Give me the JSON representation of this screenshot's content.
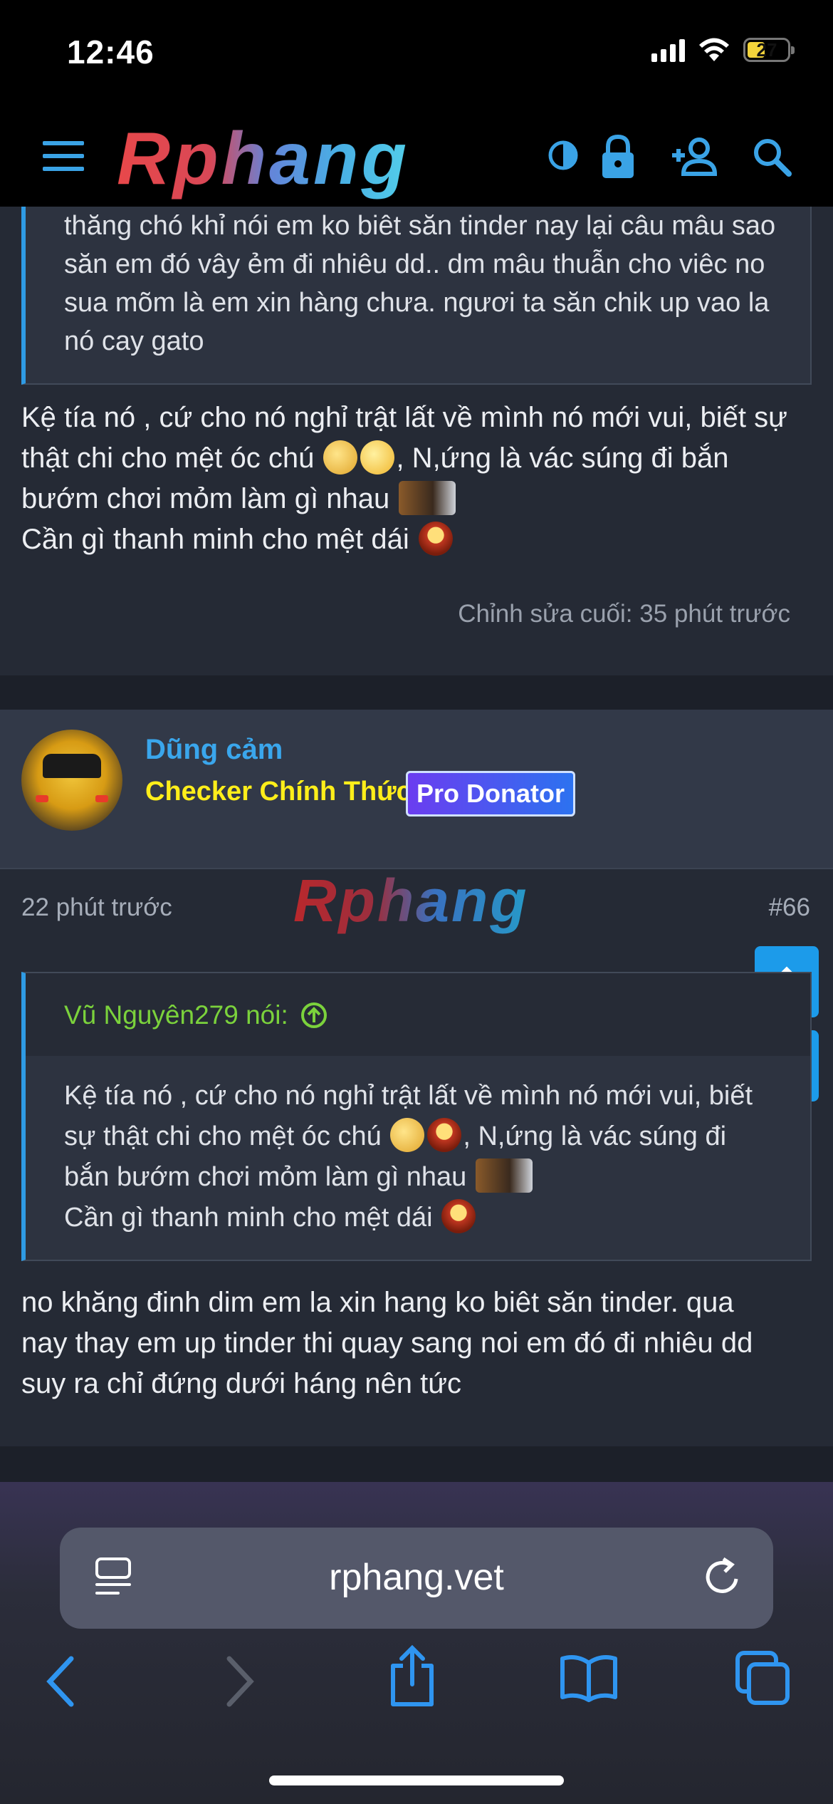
{
  "status_bar": {
    "time": "12:46",
    "battery": "27"
  },
  "header": {
    "logo": "Rphang"
  },
  "quote_top": {
    "text": "thăng chó khỉ nói em ko biêt săn tinder nay lại câu mâu sao săn em đó vây ẻm đi nhiêu dd.. dm mâu thuẫn cho viêc no sua mõm là em xin hàng chưa. ngươi ta săn chik up vao la nó cay gato"
  },
  "post1": {
    "line1": "Kệ tía nó , cứ cho nó nghỉ trật lất về mình nó mới vui, biết sự",
    "line2": "thật chi cho mệt óc chú",
    "line2b": ", N,ứng là vác súng đi bắn",
    "line3": "bướm chơi mỏm làm gì nhau",
    "line4": "Cần gì thanh minh cho mệt dái",
    "edited": "Chỉnh sửa cuối: 35 phút trước"
  },
  "post2": {
    "username": "Dũng cảm",
    "rank": "Checker Chính Thức",
    "badge": "Pro Donator",
    "time": "22 phút trước",
    "number": "#66",
    "watermark": "Rphang",
    "quote_author": "Vũ Nguyên279 nói:",
    "quote_line1": "Kệ tía nó , cứ cho nó nghỉ trật lất về mình nó mới vui, biết",
    "quote_line2": "sự thật chi cho mệt óc chú",
    "quote_line2b": ", N,ứng là vác súng đi",
    "quote_line3": "bắn bướm chơi mỏm làm gì nhau",
    "quote_line4": "Cần gì thanh minh cho mệt dái",
    "body_line1": "no khăng đinh dim em la xin hang ko biêt săn tinder. qua",
    "body_line2": "nay thay em up tinder thi quay sang noi em đó đi nhiêu dd",
    "body_line3": "suy ra chỉ đứng dưới háng nên tức"
  },
  "browser": {
    "url": "rphang.vet"
  }
}
